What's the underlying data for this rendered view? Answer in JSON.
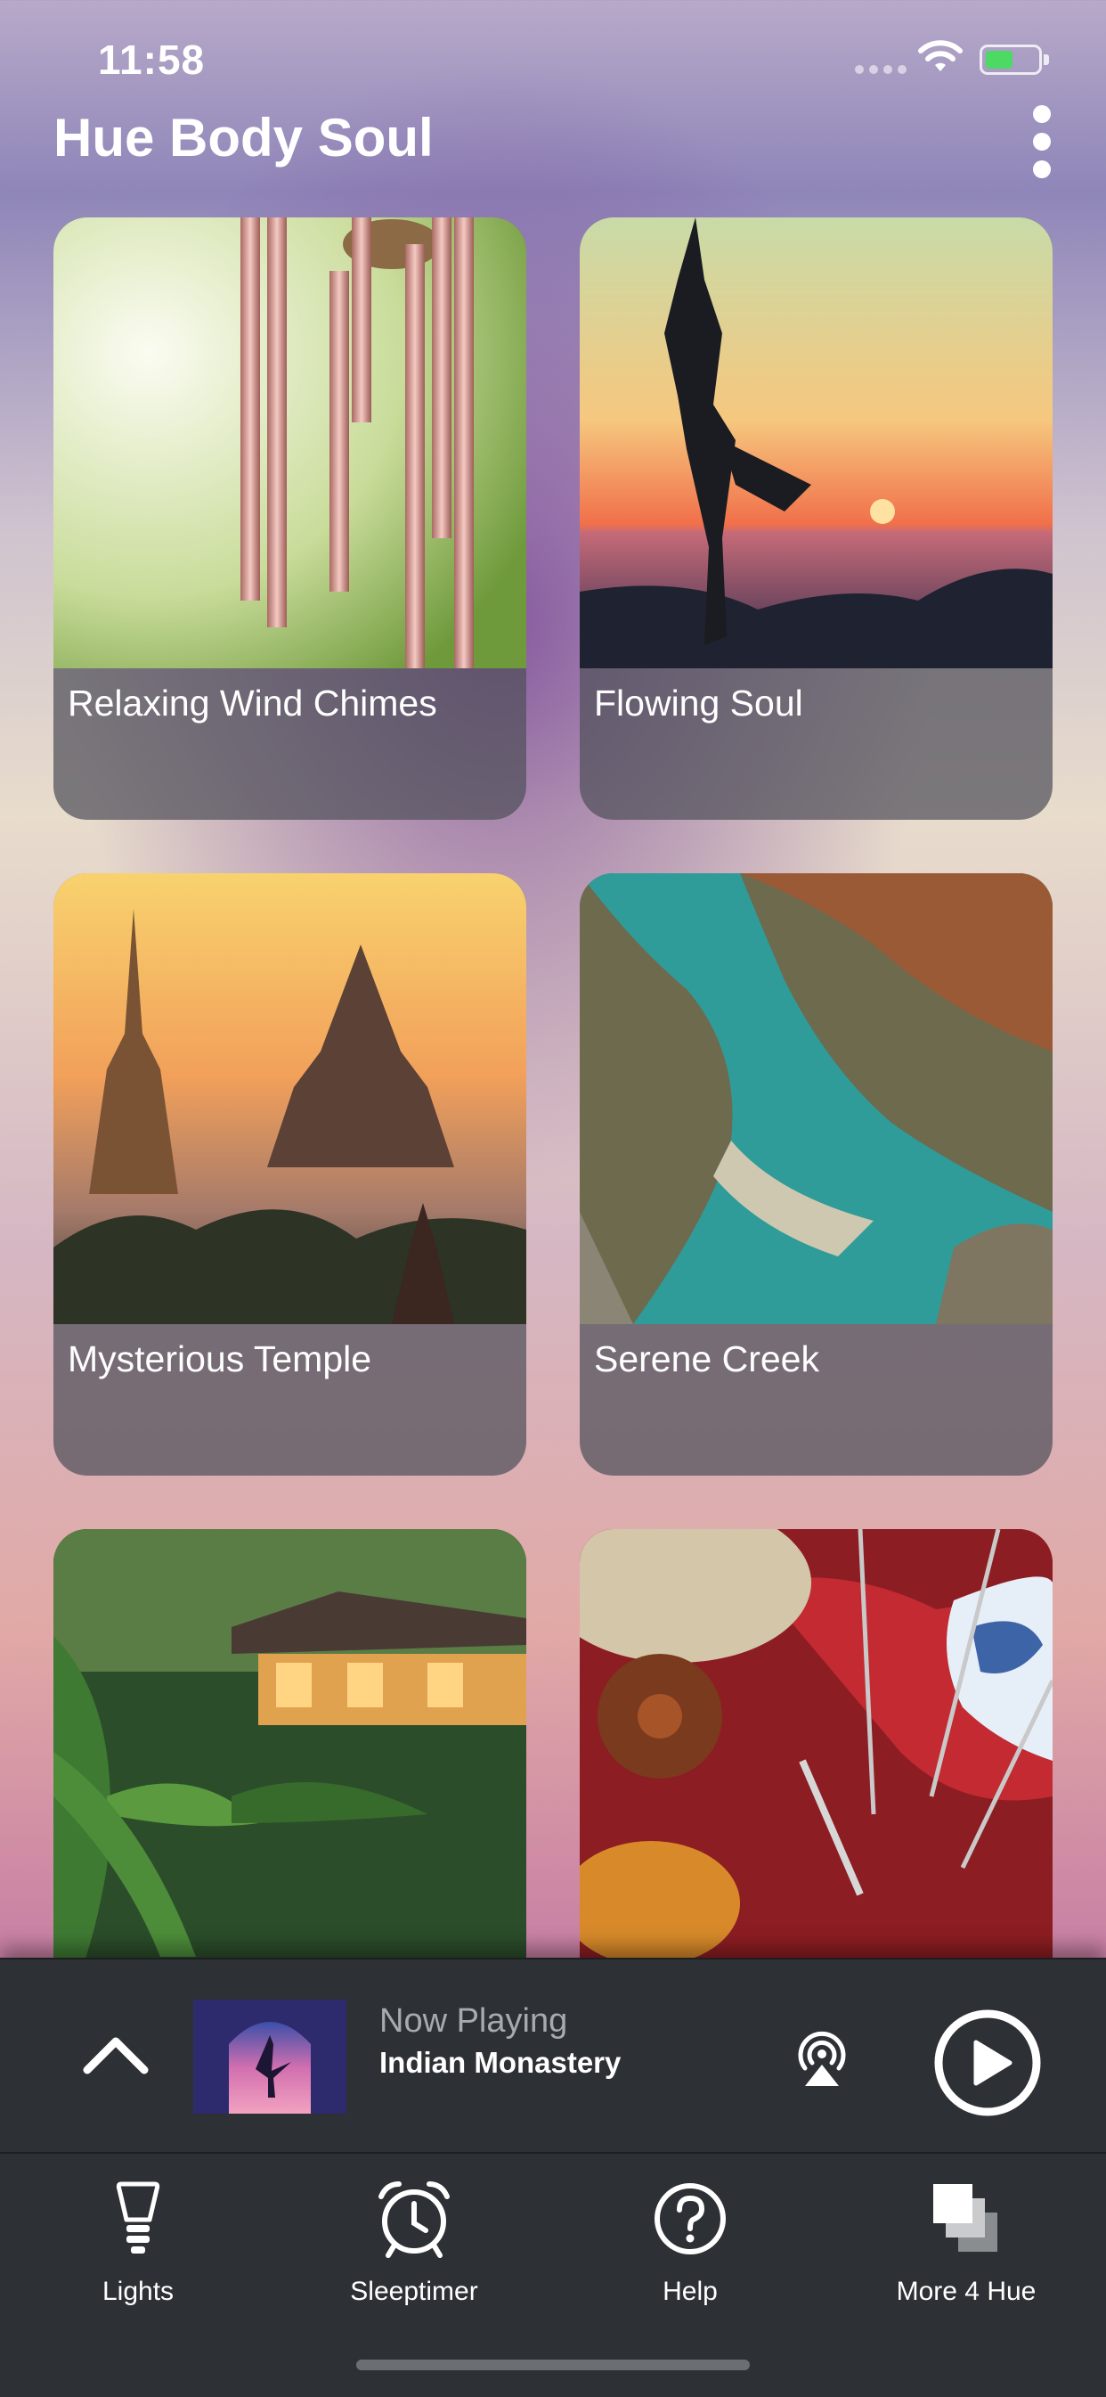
{
  "status_bar": {
    "time": "11:58",
    "battery_icon": "battery-charging-icon",
    "wifi_icon": "wifi-icon"
  },
  "header": {
    "title": "Hue Body Soul",
    "menu_icon": "more-vertical-icon"
  },
  "cards": [
    {
      "label": "Relaxing Wind Chimes"
    },
    {
      "label": "Flowing Soul"
    },
    {
      "label": "Mysterious Temple"
    },
    {
      "label": "Serene Creek"
    },
    {
      "label": ""
    },
    {
      "label": ""
    }
  ],
  "now_playing": {
    "label": "Now Playing",
    "track": "Indian Monastery",
    "expand_icon": "chevron-up-icon",
    "airplay_icon": "airplay-icon",
    "play_icon": "play-icon"
  },
  "tabs": [
    {
      "label": "Lights",
      "icon": "lightbulb-icon"
    },
    {
      "label": "Sleeptimer",
      "icon": "alarm-clock-icon"
    },
    {
      "label": "Help",
      "icon": "help-circle-icon"
    },
    {
      "label": "More 4 Hue",
      "icon": "layers-icon"
    }
  ]
}
